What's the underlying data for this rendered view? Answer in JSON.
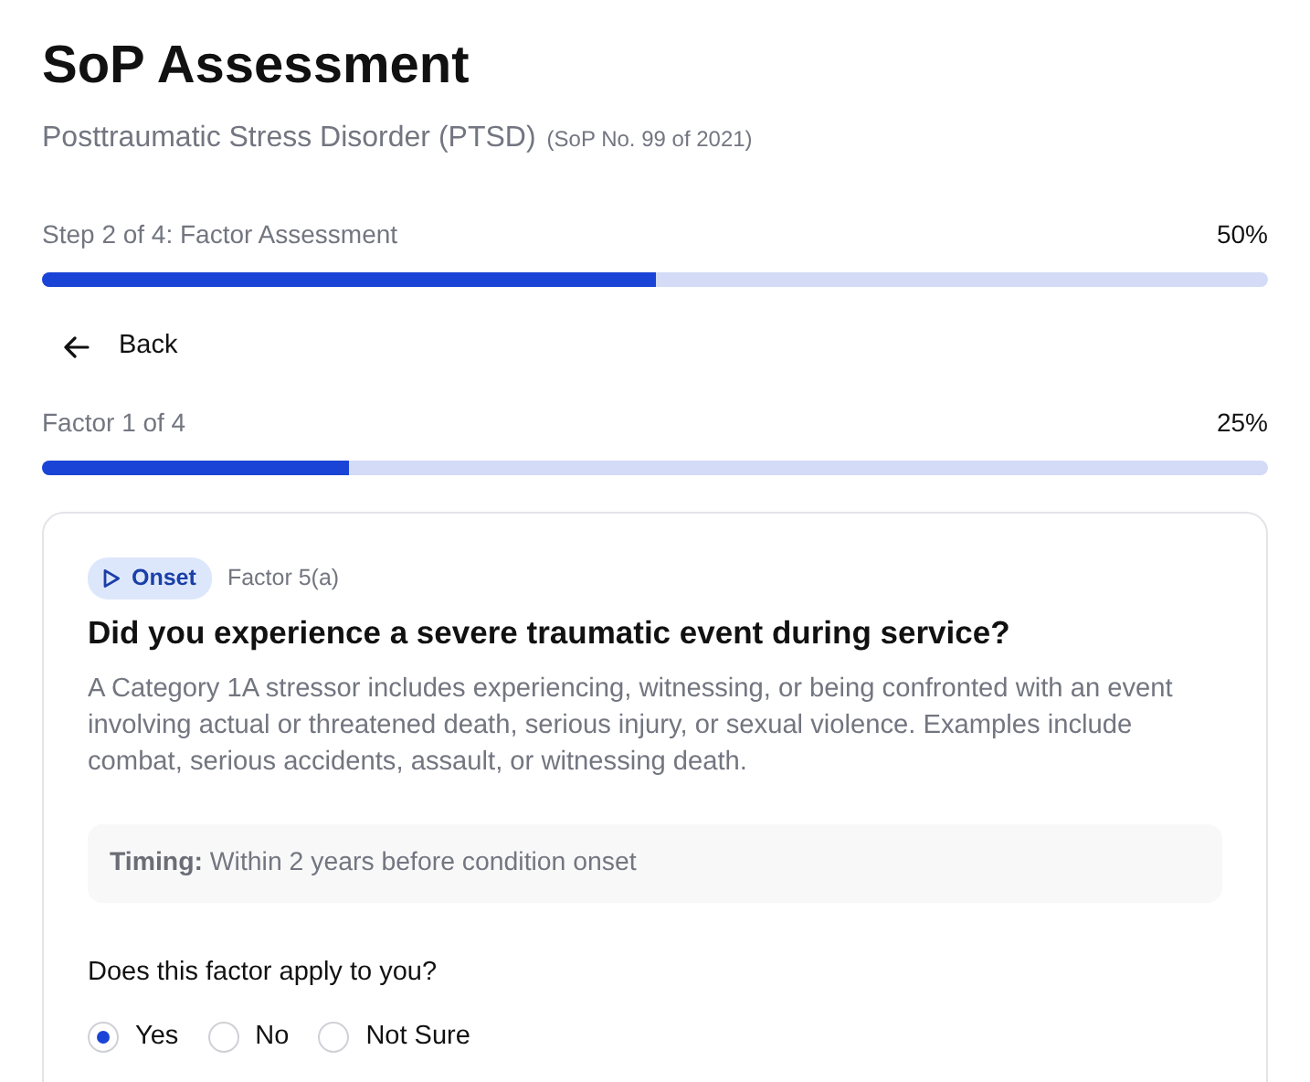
{
  "header": {
    "title": "SoP Assessment",
    "condition": "Posttraumatic Stress Disorder (PTSD)",
    "reference": "(SoP No. 99 of 2021)"
  },
  "step_progress": {
    "label": "Step 2 of 4: Factor Assessment",
    "percent": "50%",
    "level": 0.5
  },
  "back_button": {
    "label": "Back"
  },
  "factor_progress": {
    "label": "Factor 1 of 4",
    "percent": "25%",
    "level": 0.25
  },
  "factor_card": {
    "badge": "Onset",
    "factor_ref": "Factor 5(a)",
    "question": "Did you experience a severe traumatic event during service?",
    "description": "A Category 1A stressor includes experiencing, witnessing, or being confronted with an event involving actual or threatened death, serious injury, or sexual violence. Examples include combat, serious accidents, assault, or witnessing death.",
    "timing": "**Timing:** Within 2 years before condition onset",
    "prompt": "Does this factor apply to you?",
    "options": [
      {
        "label": "Yes",
        "selected": true
      },
      {
        "label": "No",
        "selected": false
      },
      {
        "label": "Not Sure",
        "selected": false
      }
    ]
  }
}
